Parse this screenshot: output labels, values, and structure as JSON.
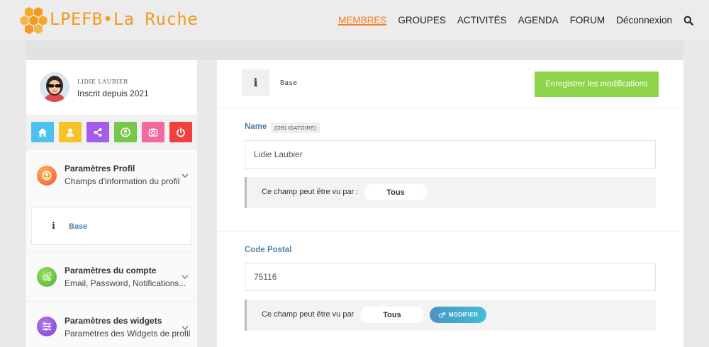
{
  "header": {
    "logo_text": "LPEFB•La Ruche",
    "nav": [
      {
        "label": "MEMBRES",
        "active": true
      },
      {
        "label": "GROUPES",
        "active": false
      },
      {
        "label": "ACTIVITÉS",
        "active": false
      },
      {
        "label": "AGENDA",
        "active": false
      },
      {
        "label": "FORUM",
        "active": false
      },
      {
        "label": "Déconnexion",
        "active": false
      }
    ],
    "search_icon": "search-icon",
    "accent": "#f47b20"
  },
  "profile": {
    "name": "Lidie Laubier",
    "since": "Inscrit depuis 2021"
  },
  "quick_actions": [
    {
      "icon": "home-icon",
      "color": "#4ec1ef"
    },
    {
      "icon": "user-icon",
      "color": "#f7c325"
    },
    {
      "icon": "share-icon",
      "color": "#a55ce8"
    },
    {
      "icon": "account-circle-icon",
      "color": "#77c84a"
    },
    {
      "icon": "camera-icon",
      "color": "#f56a9e"
    },
    {
      "icon": "power-icon",
      "color": "#f23f3f"
    }
  ],
  "sidebar": {
    "groups": [
      {
        "title": "Paramètres Profil",
        "subtitle": "Champs d'information du profil",
        "icon": "profile-settings-icon"
      },
      {
        "title": "Paramètres du compte",
        "subtitle": "Email, Password, Notifications...",
        "icon": "account-settings-icon"
      },
      {
        "title": "Paramètres des widgets",
        "subtitle": "Paramètres des Widgets de profil",
        "icon": "widget-settings-icon"
      }
    ],
    "active_sub": {
      "label": "Base",
      "icon": "info-icon"
    }
  },
  "main": {
    "section_title": "Base",
    "save_label": "Enregistrer les modifications",
    "fields": [
      {
        "label": "Name",
        "required_tag": "(OBLIGATOIRE)",
        "value": "Lidie Laubier",
        "visibility_text": "Ce champ peut être vu par :",
        "visibility_value": "Tous"
      },
      {
        "label": "Code Postal",
        "value": "75116",
        "visibility_text": "Ce champ peut être vu par",
        "visibility_value": "Tous",
        "modify_label": "MODIFIER"
      }
    ]
  }
}
